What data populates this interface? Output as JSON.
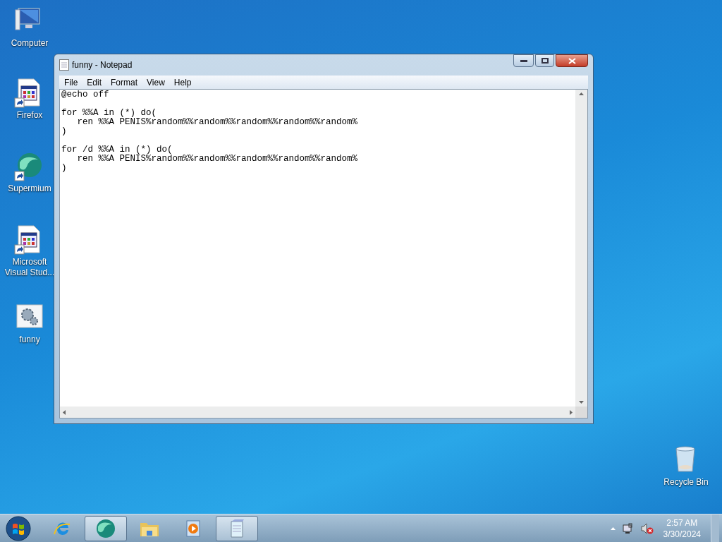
{
  "desktop_icons": [
    {
      "label": "Computer",
      "kind": "computer",
      "shortcut": false
    },
    {
      "label": "Firefox",
      "kind": "app",
      "shortcut": true
    },
    {
      "label": "Supermium",
      "kind": "browser",
      "shortcut": true
    },
    {
      "label": "Microsoft Visual Stud...",
      "kind": "app",
      "shortcut": true
    },
    {
      "label": "funny",
      "kind": "batch",
      "shortcut": false
    },
    {
      "label": "Recycle Bin",
      "kind": "bin",
      "shortcut": false
    }
  ],
  "window": {
    "title": "funny - Notepad"
  },
  "menu": [
    "File",
    "Edit",
    "Format",
    "View",
    "Help"
  ],
  "editor": {
    "paragraphs": [
      [
        "@echo off"
      ],
      [
        "for %%A in (*) do(",
        "   ren %%A PENIS%random%%random%%random%%random%%random%",
        ")"
      ],
      [
        "for /d %%A in (*) do(",
        "   ren %%A PENIS%random%%random%%random%%random%%random%",
        ")"
      ]
    ]
  },
  "taskbar": {
    "items": [
      {
        "kind": "ie",
        "running": false
      },
      {
        "kind": "browser",
        "running": true
      },
      {
        "kind": "folder",
        "running": false
      },
      {
        "kind": "media",
        "running": false
      },
      {
        "kind": "notepad",
        "running": true
      }
    ],
    "clock": {
      "time": "2:57 AM",
      "date": "3/30/2024"
    }
  }
}
